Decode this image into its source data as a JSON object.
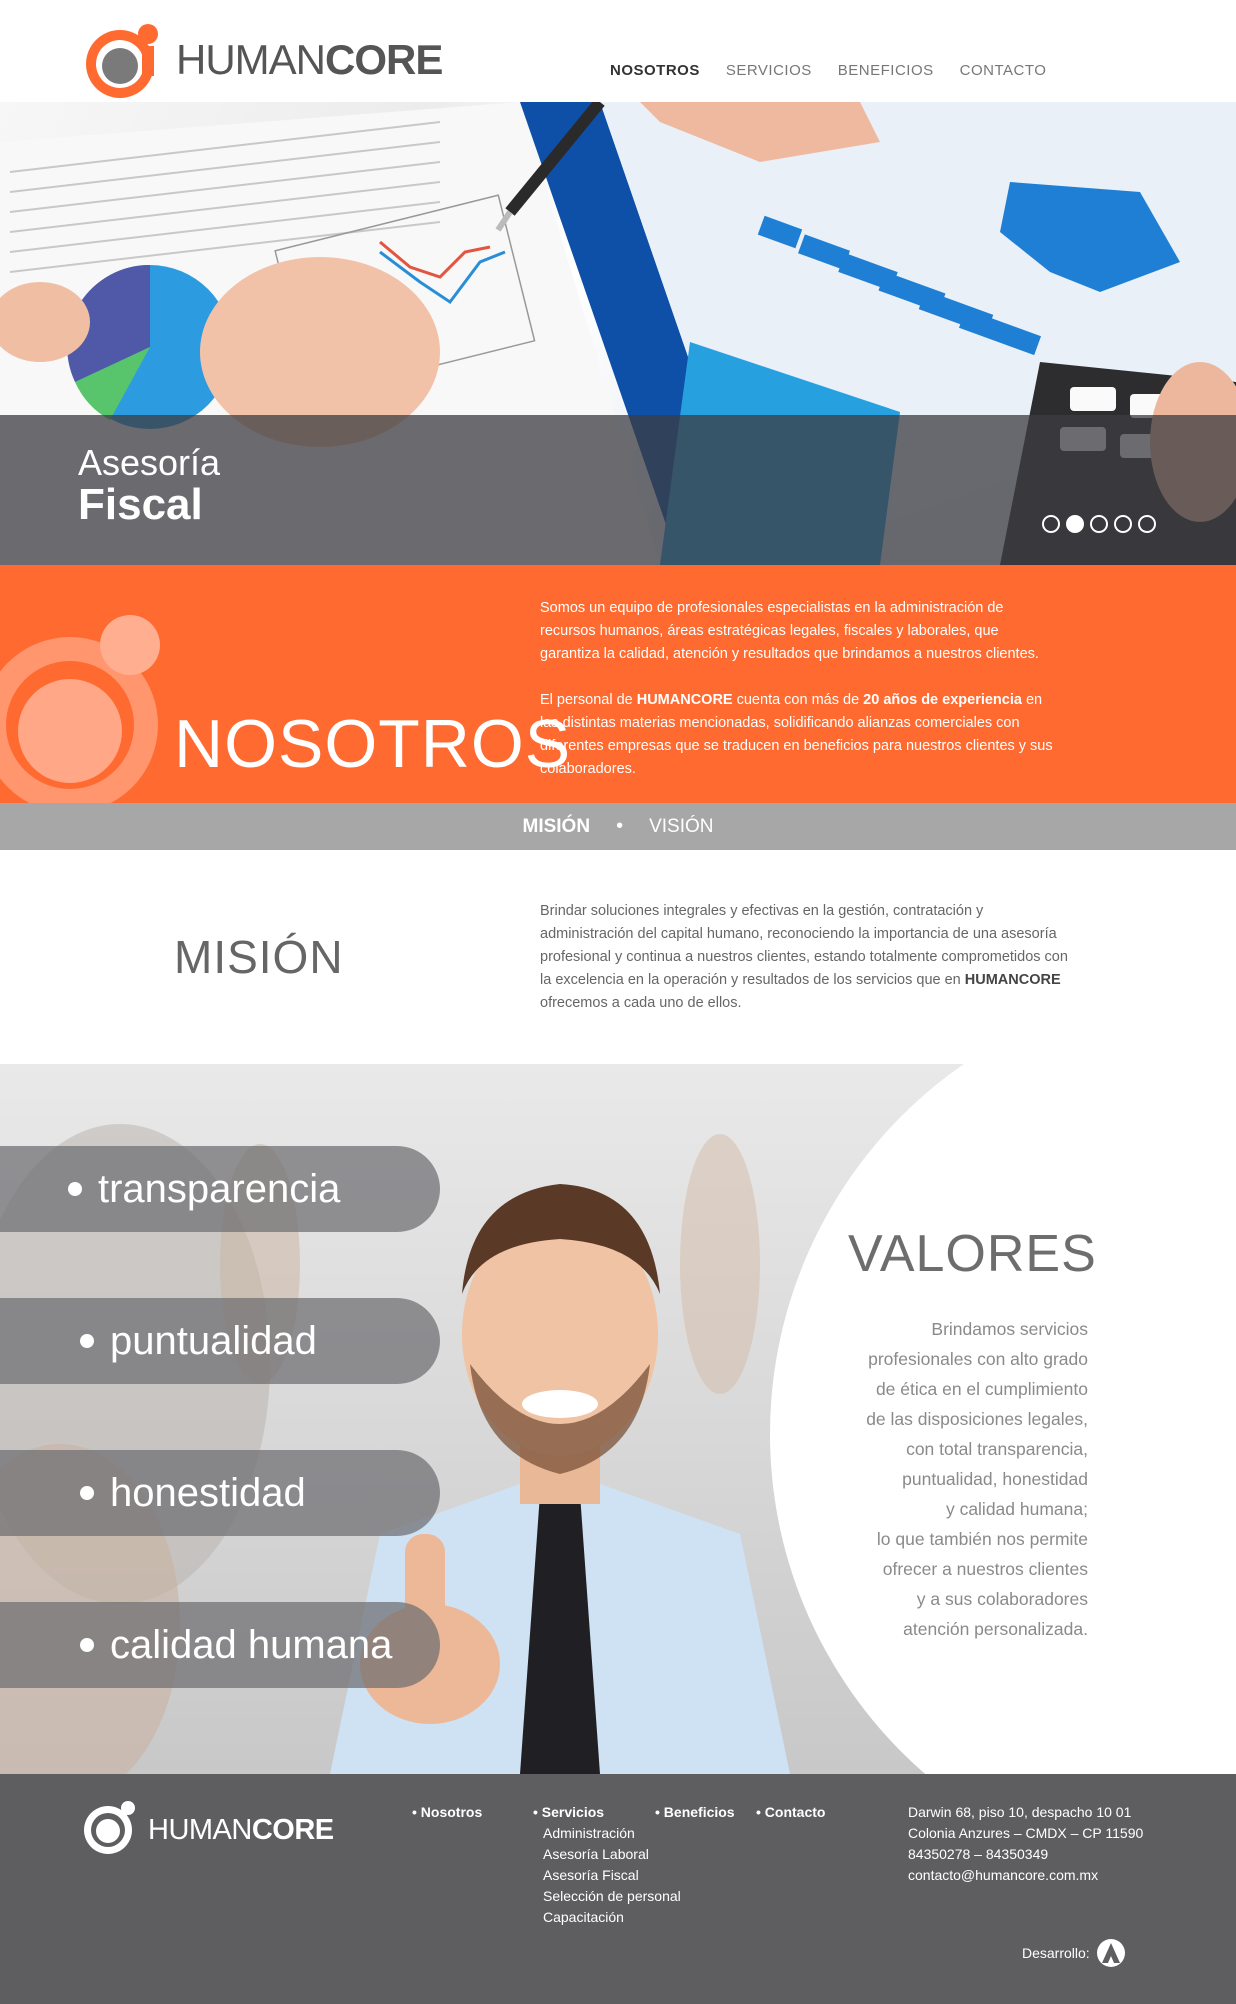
{
  "brand": {
    "name_light": "HUMAN",
    "name_bold": "CORE",
    "accent": "#ff6a30"
  },
  "nav": {
    "items": [
      "NOSOTROS",
      "SERVICIOS",
      "BENEFICIOS",
      "CONTACTO"
    ],
    "active": "NOSOTROS"
  },
  "hero": {
    "line1": "Asesoría",
    "line2": "Fiscal",
    "slide_count": 5,
    "active_slide": 2
  },
  "nosotros": {
    "title": "NOSOTROS",
    "p1": "Somos un equipo de profesionales especialistas en la administración de recursos humanos, áreas estratégicas legales, fiscales y laborales, que garantiza la calidad, atención y resultados que brindamos a nuestros clientes.",
    "p2_a": "El personal de ",
    "p2_brand": "HUMANCORE",
    "p2_b": " cuenta con más de  ",
    "p2_years": "20 años de experiencia",
    "p2_c": " en las distintas materias mencionadas, solidificando alianzas comerciales con diferentes empresas que se traducen en beneficios para nuestros clientes y sus colaboradores."
  },
  "tabs": {
    "mision": "MISIÓN",
    "separator": "•",
    "vision": "VISIÓN"
  },
  "mision": {
    "title": "MISIÓN",
    "text_a": "Brindar soluciones integrales y efectivas en la gestión, contratación y administración del capital humano, reconociendo la importancia de una asesoría profesional y continua a nuestros clientes, estando totalmente comprometidos con la excelencia en la operación y resultados de los servicios que en ",
    "text_brand": "HUMANCORE",
    "text_b": " ofrecemos a cada uno de ellos."
  },
  "valores": {
    "title": "VALORES",
    "pills": [
      "transparencia",
      "puntualidad",
      "honestidad",
      "calidad humana"
    ],
    "lines": [
      "Brindamos servicios",
      "profesionales con alto grado",
      "de ética en el cumplimiento",
      "de las disposiciones legales,",
      "con total transparencia,",
      "puntualidad, honestidad",
      "y calidad humana;",
      "lo que también nos permite",
      "ofrecer a nuestros clientes",
      "y a sus colaboradores",
      "atención personalizada."
    ]
  },
  "footer": {
    "nosotros": "• Nosotros",
    "servicios": "• Servicios",
    "servicios_items": [
      "Administración",
      "Asesoría Laboral",
      "Asesoría Fiscal",
      "Selección de personal",
      "Capacitación"
    ],
    "beneficios": "• Beneficios",
    "contacto": "• Contacto",
    "address": [
      "Darwin 68, piso 10, despacho 10 01",
      "Colonia Anzures – CMDX – CP 11590",
      "84350278 – 84350349",
      "contacto@humancore.com.mx"
    ],
    "dev_label": "Desarrollo:"
  }
}
